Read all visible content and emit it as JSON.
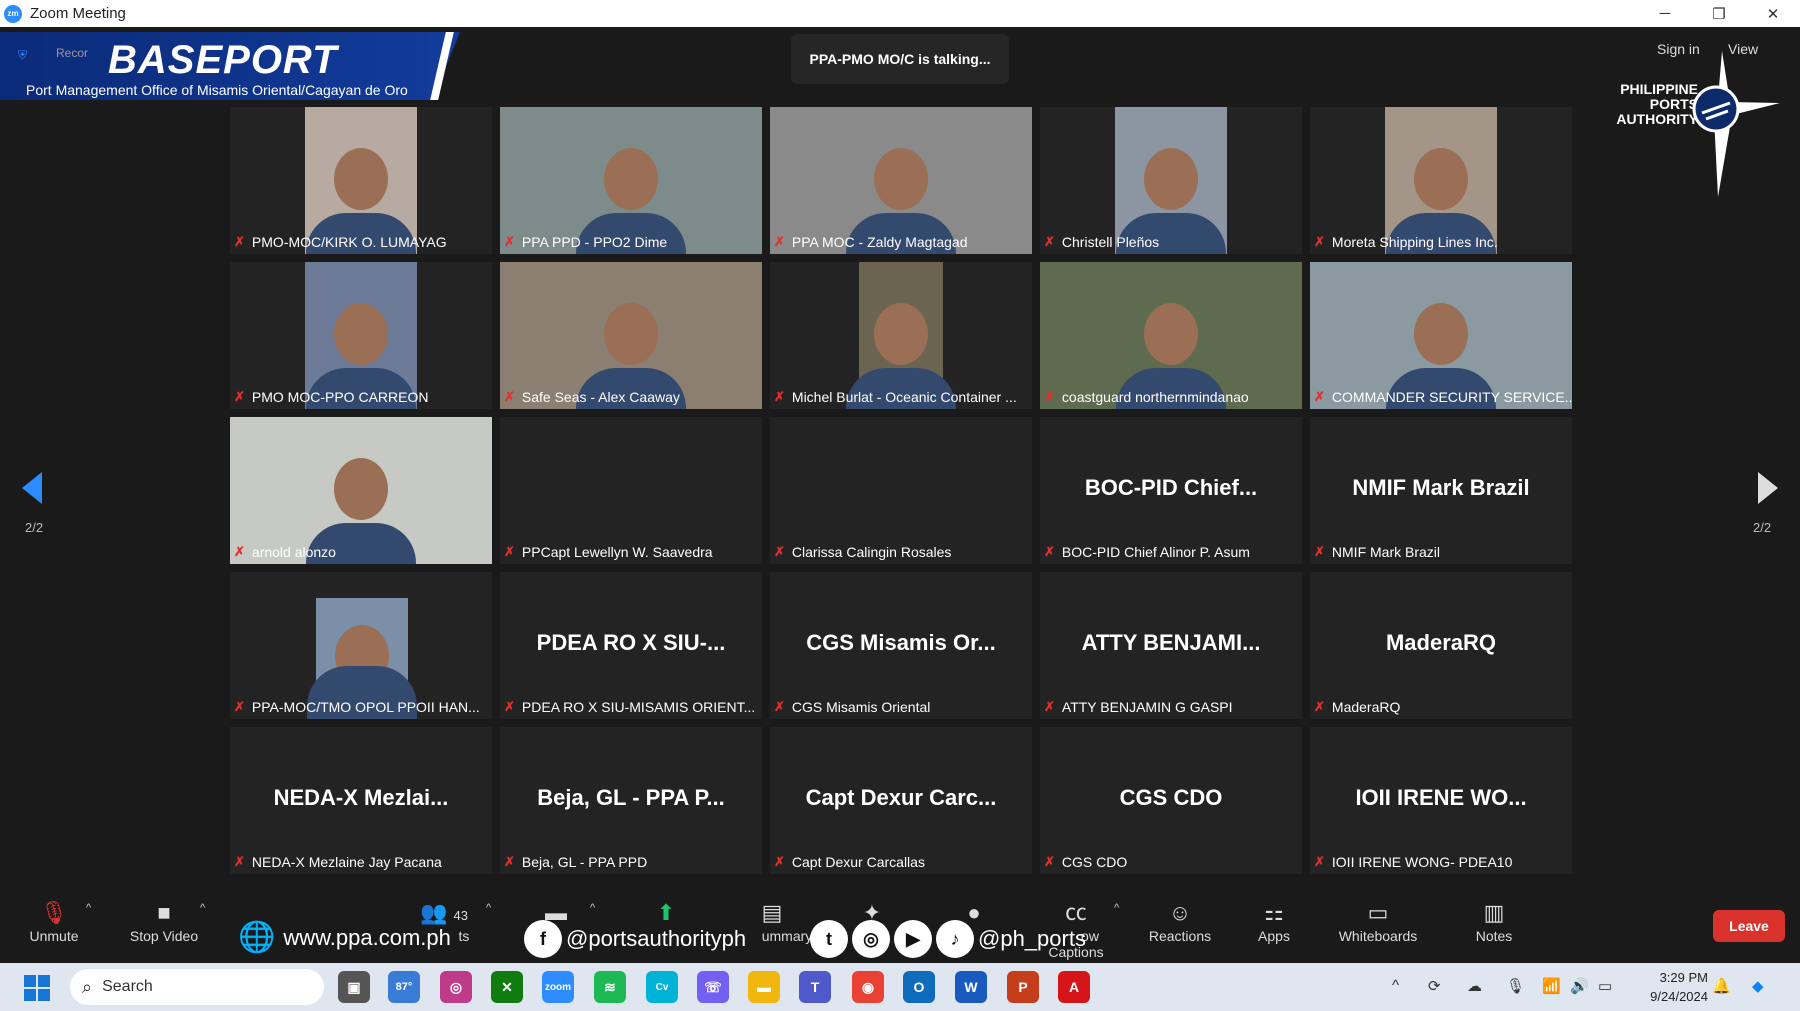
{
  "window": {
    "title": "Zoom Meeting",
    "minimize": "─",
    "restore": "❐",
    "close": "✕"
  },
  "overlay": {
    "brand": "BASEPORT",
    "brand_sub": "Port Management Office of Misamis Oriental/Cagayan de Oro",
    "rec": "Recor",
    "ppa": [
      "PHILIPPINE",
      "PORTS",
      "AUTHORITY"
    ],
    "website": "www.ppa.com.ph",
    "facebook": "@portsauthorityph",
    "social2": "@ph_ports"
  },
  "meeting": {
    "talking": "PPA-PMO MO/C is talking...",
    "sign_in": "Sign in",
    "view": "View",
    "page_left": "2/2",
    "page_right": "2/2"
  },
  "tiles": [
    {
      "label": "PMO-MOC/KIRK O. LUMAYAG",
      "big": ""
    },
    {
      "label": "PPA PPD - PPO2 Dime",
      "big": ""
    },
    {
      "label": "PPA MOC - Zaldy Magtagad",
      "big": ""
    },
    {
      "label": "Christell Pleños",
      "big": ""
    },
    {
      "label": "Moreta Shipping Lines Inc.",
      "big": ""
    },
    {
      "label": "PMO MOC-PPO CARREON",
      "big": ""
    },
    {
      "label": "Safe Seas - Alex Caaway",
      "big": ""
    },
    {
      "label": "Michel Burlat - Oceanic Container ...",
      "big": ""
    },
    {
      "label": "coastguard northernmindanao",
      "big": ""
    },
    {
      "label": "COMMANDER SECURITY SERVICE...",
      "big": ""
    },
    {
      "label": "arnold alonzo",
      "big": ""
    },
    {
      "label": "PPCapt Lewellyn W. Saavedra",
      "big": ""
    },
    {
      "label": "Clarissa Calingin Rosales",
      "big": ""
    },
    {
      "label": "BOC-PID Chief Alinor P. Asum",
      "big": "BOC-PID  Chief..."
    },
    {
      "label": "NMIF Mark Brazil",
      "big": "NMIF Mark Brazil"
    },
    {
      "label": "PPA-MOC/TMO OPOL PPOII HAN...",
      "big": ""
    },
    {
      "label": "PDEA RO X SIU-MISAMIS ORIENT...",
      "big": "PDEA RO X SIU-..."
    },
    {
      "label": "CGS Misamis Oriental",
      "big": "CGS  Misamis Or..."
    },
    {
      "label": "ATTY BENJAMIN G GASPI",
      "big": "ATTY  BENJAMI..."
    },
    {
      "label": "MaderaRQ",
      "big": "MaderaRQ"
    },
    {
      "label": "NEDA-X Mezlaine Jay Pacana",
      "big": "NEDA-X  Mezlai..."
    },
    {
      "label": "Beja, GL - PPA PPD",
      "big": "Beja, GL - PPA P..."
    },
    {
      "label": "Capt Dexur Carcallas",
      "big": "Capt Dexur Carc..."
    },
    {
      "label": "CGS CDO",
      "big": "CGS CDO"
    },
    {
      "label": "IOII IRENE WONG- PDEA10",
      "big": "IOII  IRENE  WO..."
    }
  ],
  "controls": {
    "unmute": "Unmute",
    "stop_video": "Stop Video",
    "participants_count": "43",
    "participants": "ts",
    "summary": "ummary",
    "captions": "ow Captions",
    "reactions": "Reactions",
    "apps": "Apps",
    "whiteboards": "Whiteboards",
    "notes": "Notes",
    "leave": "Leave"
  },
  "taskbar": {
    "search": "Search",
    "weather": "87°",
    "time": "3:29 PM",
    "date": "9/24/2024"
  },
  "colors": {
    "accent": "#2d8cff",
    "leave": "#d9312b",
    "mic_off": "#e0302f",
    "brand": "#0b2a78"
  }
}
